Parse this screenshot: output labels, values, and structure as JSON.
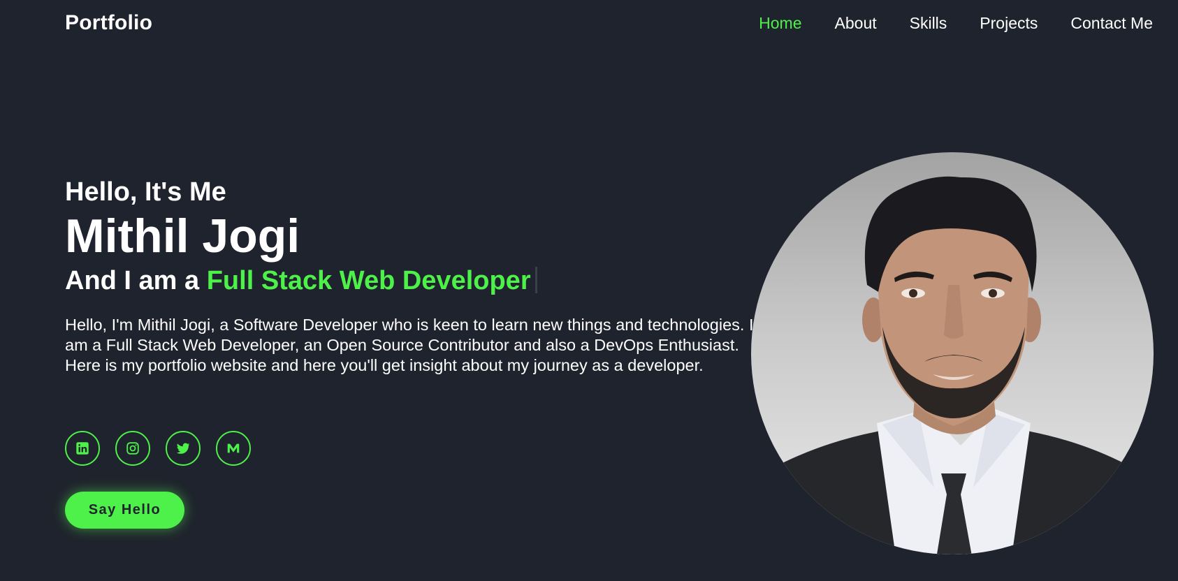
{
  "header": {
    "logo": "Portfolio",
    "nav": [
      {
        "label": "Home",
        "active": true
      },
      {
        "label": "About",
        "active": false
      },
      {
        "label": "Skills",
        "active": false
      },
      {
        "label": "Projects",
        "active": false
      },
      {
        "label": "Contact Me",
        "active": false
      }
    ]
  },
  "hero": {
    "greeting": "Hello, It's Me",
    "name": "Mithil Jogi",
    "role_prefix": "And I am a ",
    "role_highlight": "Full Stack Web Developer",
    "intro": "Hello, I'm Mithil Jogi, a Software Developer who is keen to learn new things and technologies. I am a Full Stack Web Developer, an Open Source Contributor and also a DevOps Enthusiast. Here is my portfolio website and here you'll get insight about my journey as a developer.",
    "socials": [
      {
        "icon": "linkedin-icon"
      },
      {
        "icon": "instagram-icon"
      },
      {
        "icon": "twitter-icon"
      },
      {
        "icon": "medium-icon"
      }
    ],
    "cta_label": "Say Hello"
  },
  "colors": {
    "background": "#1f232d",
    "accent": "#4ef04a",
    "text": "#ffffff"
  }
}
